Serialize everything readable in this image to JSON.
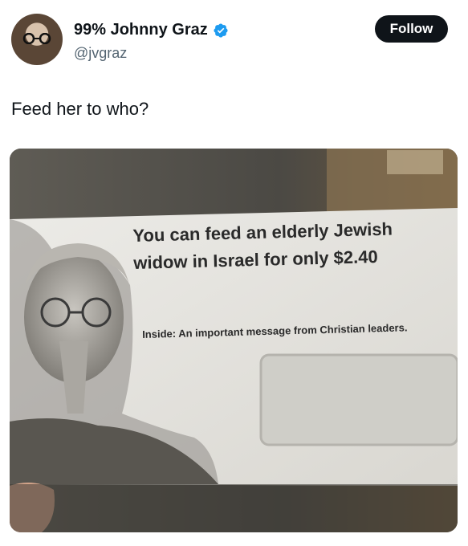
{
  "author": {
    "display_name": "99% Johnny Graz",
    "handle": "@jvgraz",
    "verified": true
  },
  "follow_label": "Follow",
  "tweet_text": "Feed her to who?",
  "media": {
    "headline": "You can feed an elderly Jewish widow in Israel for only $2.40",
    "subline": "Inside: An important message from Christian leaders."
  },
  "colors": {
    "text": "#0f1419",
    "secondary": "#536471",
    "verified": "#1d9bf0",
    "button_bg": "#0f1419"
  }
}
